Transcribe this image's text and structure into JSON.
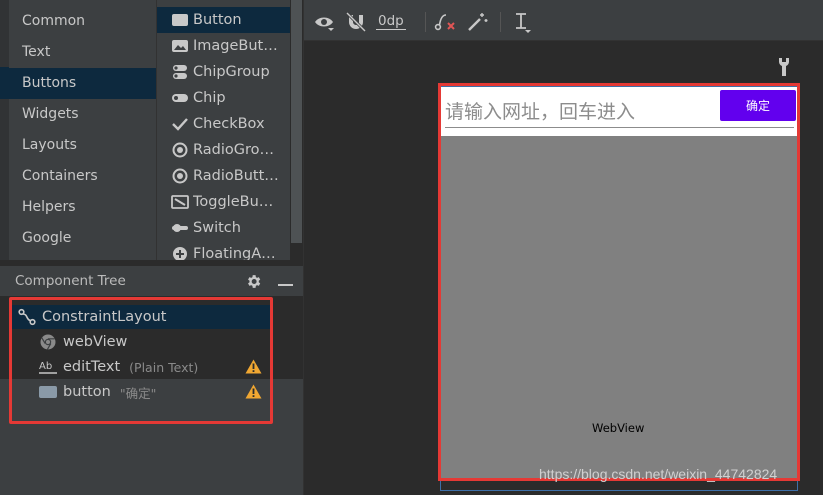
{
  "palette": {
    "categories": [
      {
        "label": "Common",
        "selected": false
      },
      {
        "label": "Text",
        "selected": false
      },
      {
        "label": "Buttons",
        "selected": true
      },
      {
        "label": "Widgets",
        "selected": false
      },
      {
        "label": "Layouts",
        "selected": false
      },
      {
        "label": "Containers",
        "selected": false
      },
      {
        "label": "Helpers",
        "selected": false
      },
      {
        "label": "Google",
        "selected": false
      }
    ],
    "widgets": [
      {
        "label": "Button",
        "icon": "button-icon",
        "selected": true
      },
      {
        "label": "ImageBut…",
        "icon": "image-button-icon",
        "selected": false
      },
      {
        "label": "ChipGroup",
        "icon": "chip-group-icon",
        "selected": false
      },
      {
        "label": "Chip",
        "icon": "chip-icon",
        "selected": false
      },
      {
        "label": "CheckBox",
        "icon": "checkbox-icon",
        "selected": false
      },
      {
        "label": "RadioGro…",
        "icon": "radio-group-icon",
        "selected": false
      },
      {
        "label": "RadioButt…",
        "icon": "radio-button-icon",
        "selected": false
      },
      {
        "label": "ToggleBu…",
        "icon": "toggle-button-icon",
        "selected": false
      },
      {
        "label": "Switch",
        "icon": "switch-icon",
        "selected": false
      },
      {
        "label": "FloatingA…",
        "icon": "fab-icon",
        "selected": false
      }
    ]
  },
  "component_tree": {
    "title": "Component Tree",
    "nodes": [
      {
        "label": "ConstraintLayout",
        "meta": "",
        "icon": "constraint-layout-icon",
        "warning": false
      },
      {
        "label": "webView",
        "meta": "",
        "icon": "webview-icon",
        "warning": false
      },
      {
        "label": "editText",
        "meta": "(Plain Text)",
        "icon": "edittext-icon",
        "warning": true
      },
      {
        "label": "button",
        "meta": "\"确定\"",
        "icon": "button-node-icon",
        "warning": true
      }
    ]
  },
  "toolbar": {
    "margin_value": "0dp"
  },
  "device": {
    "edit_hint": "请输入网址，回车进入",
    "button_label": "确定",
    "webview_label": "WebView",
    "button_color": "#6200ee"
  },
  "watermark": "https://blog.csdn.net/weixin_44742824"
}
